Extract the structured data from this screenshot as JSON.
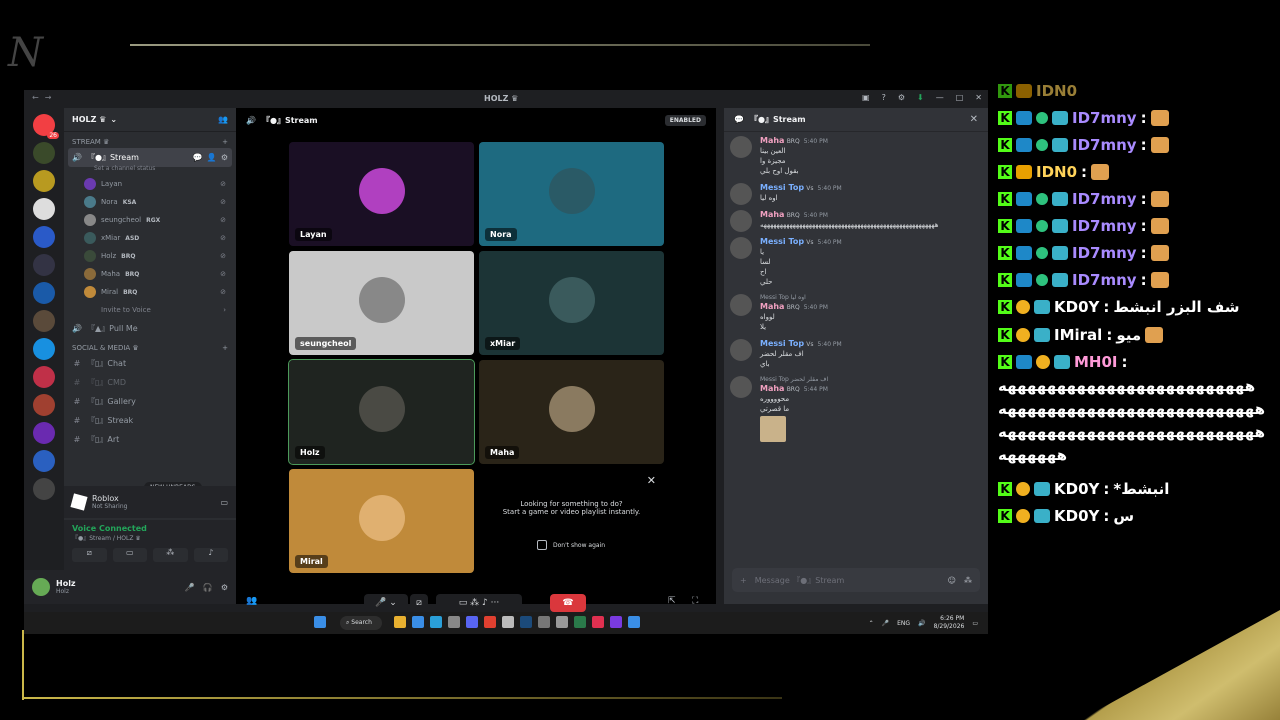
{
  "window": {
    "app_title": "HOLZ ♛"
  },
  "server": {
    "name": "HOLZ ♛",
    "unread_badge": "26"
  },
  "categories": {
    "stream": "STREAM ♛",
    "social": "SOCIAL & MEDIA ♛"
  },
  "voice_channel": {
    "name": "『●』Stream",
    "status_placeholder": "Set a channel status",
    "users": [
      {
        "name": "Layan",
        "tag": ""
      },
      {
        "name": "Nora",
        "tag": "KSA"
      },
      {
        "name": "seungcheol",
        "tag": "RGX"
      },
      {
        "name": "xMiar",
        "tag": "ASD"
      },
      {
        "name": "Holz",
        "tag": "BRQ"
      },
      {
        "name": "Maha",
        "tag": "BRQ"
      },
      {
        "name": "Miral",
        "tag": "BRQ"
      }
    ],
    "invite": "Invite to Voice"
  },
  "channels": {
    "pull_me": "『▲』Pull Me",
    "chat": "『▯』Chat",
    "cmd": "『▯』CMD",
    "gallery": "『▯』Gallery",
    "streak": "『▯』Streak",
    "art": "『▯』Art",
    "new_unreads": "NEW UNREADS"
  },
  "activity": {
    "title": "Roblox",
    "subtitle": "Not Sharing"
  },
  "voice_status": {
    "label": "Voice Connected",
    "sub": "『●』Stream / HOLZ ♛"
  },
  "user": {
    "name": "Holz",
    "sub": "Holz"
  },
  "stage": {
    "title": "『●』Stream",
    "enabled": "ENABLED",
    "tiles": [
      {
        "label": "Layan",
        "bg": "#1a0f24",
        "av": "#b040c0"
      },
      {
        "label": "Nora",
        "bg": "#1e6a80",
        "av": "#2a5a66"
      },
      {
        "label": "seungcheol",
        "bg": "#c9c9c9",
        "av": "#888888"
      },
      {
        "label": "xMiar",
        "bg": "#1c3436",
        "av": "#3a5a5c"
      },
      {
        "label": "Holz",
        "bg": "#1f2420",
        "av": "#4a4a44"
      },
      {
        "label": "Maha",
        "bg": "#2a2418",
        "av": "#8a7a60"
      },
      {
        "label": "Miral",
        "bg": "#c08a3a",
        "av": "#e0b070"
      }
    ],
    "promo_title": "Looking for something to do?",
    "promo_sub": "Start a game or video playlist instantly.",
    "promo_check": "Don't show again"
  },
  "chat": {
    "title": "『●』Stream",
    "messages": [
      {
        "author": "Maha",
        "color": "#f0a0c0",
        "tag": "BRQ",
        "time": "5:40 PM",
        "reply": "",
        "lines": [
          "العين بينا",
          "مجيزة وا",
          "بقول اوح بلي"
        ]
      },
      {
        "author": "Messi Top",
        "color": "#7ab0ff",
        "tag": "Vs",
        "time": "5:40 PM",
        "reply": "",
        "lines": [
          "اوه ليا"
        ]
      },
      {
        "author": "Maha",
        "color": "#f0a0c0",
        "tag": "BRQ",
        "time": "5:40 PM",
        "reply": "",
        "lines": [
          "ههههههههههههههههههههههههههههههههههههههههههههههههههههههه"
        ]
      },
      {
        "author": "Messi Top",
        "color": "#7ab0ff",
        "tag": "Vs",
        "time": "5:40 PM",
        "reply": "",
        "lines": [
          "يا",
          "لسا",
          "اح",
          "حلي"
        ]
      },
      {
        "author": "Maha",
        "color": "#f0a0c0",
        "tag": "BRQ",
        "time": "5:40 PM",
        "reply": "Messi Top  اوه ليا",
        "lines": [
          "لوواه",
          "يلا"
        ]
      },
      {
        "author": "Messi Top",
        "color": "#7ab0ff",
        "tag": "Vs",
        "time": "5:40 PM",
        "reply": "",
        "lines": [
          "اف مقلر لحضر",
          "باي"
        ]
      },
      {
        "author": "Maha",
        "color": "#f0a0c0",
        "tag": "BRQ",
        "time": "5:44 PM",
        "reply": "Messi Top  اف مقلر لحضر",
        "lines": [
          "محووووره",
          "ما قصرتي"
        ]
      }
    ],
    "input_placeholder": "Message 『●』Stream"
  },
  "taskbar": {
    "search": "Search",
    "lang": "ENG",
    "time": "6:26 PM",
    "date": "8/29/2026"
  },
  "stream_chat": [
    {
      "badges": [
        "blue",
        "green",
        "sub"
      ],
      "name": "ID7mny",
      "name_color": "#a98bff",
      "msg": "",
      "emote": true
    },
    {
      "badges": [
        "blue",
        "green",
        "sub"
      ],
      "name": "ID7mny",
      "name_color": "#a98bff",
      "msg": "",
      "emote": true
    },
    {
      "badges": [
        "gold"
      ],
      "name": "IDN0",
      "name_color": "#ffd35a",
      "msg": "",
      "emote": true
    },
    {
      "badges": [
        "blue",
        "green",
        "sub"
      ],
      "name": "ID7mny",
      "name_color": "#a98bff",
      "msg": "",
      "emote": true
    },
    {
      "badges": [
        "blue",
        "green",
        "sub"
      ],
      "name": "ID7mny",
      "name_color": "#a98bff",
      "msg": "",
      "emote": true
    },
    {
      "badges": [
        "blue",
        "green",
        "sub"
      ],
      "name": "ID7mny",
      "name_color": "#a98bff",
      "msg": "",
      "emote": true
    },
    {
      "badges": [
        "blue",
        "green",
        "sub"
      ],
      "name": "ID7mny",
      "name_color": "#a98bff",
      "msg": "",
      "emote": true
    },
    {
      "badges": [
        "one",
        "sub"
      ],
      "name": "KD0Y",
      "name_color": "#ffffff",
      "msg": "شف البزر انبشط",
      "emote": false
    },
    {
      "badges": [
        "one",
        "sub"
      ],
      "name": "IMiral",
      "name_color": "#ffffff",
      "msg": "ميو",
      "emote": true
    },
    {
      "badges": [
        "blue",
        "one",
        "sub"
      ],
      "name": "MH0I",
      "name_color": "#ff9ad8",
      "msg": "",
      "emote": false
    },
    {
      "badges": [
        "one",
        "sub"
      ],
      "name": "KD0Y",
      "name_color": "#ffffff",
      "msg": "انبشط*",
      "emote": false
    },
    {
      "badges": [
        "one",
        "sub"
      ],
      "name": "KD0Y",
      "name_color": "#ffffff",
      "msg": "س",
      "emote": false
    }
  ],
  "stream_chat_wrap": [
    "هههههههههههههههههههههههههه",
    "ههههههههههههههههههههههههههه",
    "ههههههههههههههههههههههههههه",
    "ههههههه"
  ]
}
